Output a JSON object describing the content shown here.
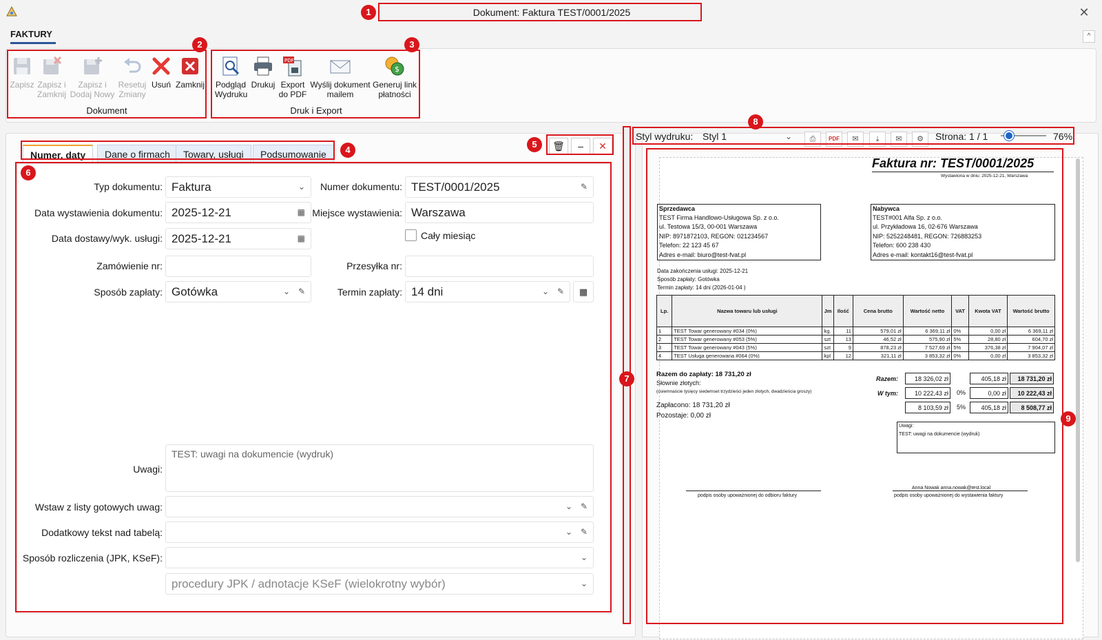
{
  "window": {
    "title": "Dokument: Faktura TEST/0001/2025",
    "close_glyph": "✕"
  },
  "ribbon": {
    "tab": "FAKTURY",
    "collapse_glyph": "^",
    "groups": [
      {
        "label": "Dokument"
      },
      {
        "label": "Druk i Export"
      }
    ],
    "buttons": {
      "save": "Zapisz",
      "save_close_1": "Zapisz i",
      "save_close_2": "Zamknij",
      "save_new_1": "Zapisz i",
      "save_new_2": "Dodaj Nowy",
      "reset_1": "Resetuj",
      "reset_2": "Zmiany",
      "delete": "Usuń",
      "close": "Zamknij",
      "preview_1": "Podgląd",
      "preview_2": "Wydruku",
      "print": "Drukuj",
      "pdf_1": "Export",
      "pdf_2": "do PDF",
      "mail_1": "Wyślij dokument",
      "mail_2": "mailem",
      "paylink_1": "Generuj link",
      "paylink_2": "płatności"
    }
  },
  "badges": [
    "1",
    "2",
    "3",
    "4",
    "5",
    "6",
    "7",
    "8",
    "9"
  ],
  "tabs": [
    "Numer, daty",
    "Dane o firmach",
    "Towary, usługi",
    "Podsumowanie"
  ],
  "tab_buttons": {
    "clear": "🗑",
    "minimize": "–",
    "close": "✕"
  },
  "form": {
    "doc_type_label": "Typ dokumentu:",
    "doc_type_value": "Faktura",
    "doc_number_label": "Numer dokumentu:",
    "doc_number_value": "TEST/0001/2025",
    "issue_date_label": "Data wystawienia dokumentu:",
    "issue_date_value": "2025-12-21",
    "place_label": "Miejsce wystawienia:",
    "place_value": "Warszawa",
    "delivery_date_label": "Data dostawy/wyk. usługi:",
    "delivery_date_value": "2025-12-21",
    "whole_month_label": "Cały miesiąc",
    "order_label": "Zamówienie nr:",
    "order_value": "",
    "shipment_label": "Przesyłka nr:",
    "shipment_value": "",
    "payment_label": "Sposób zapłaty:",
    "payment_value": "Gotówka",
    "due_label": "Termin zapłaty:",
    "due_value": "14 dni",
    "notes_label": "Uwagi:",
    "notes_value": "TEST: uwagi na dokumencie (wydruk)",
    "ready_notes_label": "Wstaw z listy gotowych uwag:",
    "extra_text_label": "Dodatkowy tekst nad tabelą:",
    "settlement_label": "Sposób rozliczenia (JPK, KSeF):",
    "procedures_placeholder": "procedury JPK / adnotacje KSeF (wielokrotny wybór)"
  },
  "preview_toolbar": {
    "style_label": "Styl wydruku:",
    "style_value": "Styl 1",
    "page_label": "Strona: 1 / 1",
    "zoom": "76%",
    "zoom_level": 0.18
  },
  "invoice": {
    "title": "Faktura nr: TEST/0001/2025",
    "issued": "Wystawiona w dniu: 2025-12-21, Warszawa",
    "seller": {
      "heading": "Sprzedawca",
      "lines": [
        "TEST Firma Handlowo-Usługowa Sp. z o.o.",
        "ul. Testowa 15/3, 00-001 Warszawa",
        "NIP: 8971872103, REGON: 021234567",
        "Telefon: 22 123 45 67",
        "Adres e-mail: biuro@test-fvat.pl"
      ]
    },
    "buyer": {
      "heading": "Nabywca",
      "lines": [
        "TEST#001 Alfa Sp. z o.o.",
        "ul. Przykładowa 16, 02-676 Warszawa",
        "NIP: 5252248481, REGON: 726883253",
        "Telefon: 600 238 430",
        "Adres e-mail: kontakt16@test-fvat.pl"
      ]
    },
    "meta": [
      "Data zakończenia usługi: 2025-12-21",
      "Sposób zapłaty: Gotówka",
      "Termin zapłaty: 14 dni (2026-01-04 )"
    ],
    "columns": [
      "Lp.",
      "Nazwa towaru lub usługi",
      "Jm",
      "Ilość",
      "Cena brutto",
      "Wartość netto",
      "VAT",
      "Kwota VAT",
      "Wartość brutto"
    ],
    "rows": [
      [
        "1",
        "TEST Towar generowany #034 (0%)",
        "kg.",
        "11",
        "579,01 zł",
        "6 369,11 zł",
        "0%",
        "0,00 zł",
        "6 369,11 zł"
      ],
      [
        "2",
        "TEST Towar generowany #053 (5%)",
        "szt",
        "13",
        "46,52 zł",
        "575,90 zł",
        "5%",
        "28,80 zł",
        "604,70 zł"
      ],
      [
        "3",
        "TEST Towar generowany #043 (5%)",
        "szt",
        "9",
        "878,23 zł",
        "7 527,69 zł",
        "5%",
        "376,38 zł",
        "7 904,07 zł"
      ],
      [
        "4",
        "TEST Usługa generowana #064 (0%)",
        "kpl",
        "12",
        "321,11 zł",
        "3 853,32 zł",
        "0%",
        "0,00 zł",
        "3 853,32 zł"
      ]
    ],
    "total_label": "Razem do zapłaty: 18 731,20 zł",
    "words_label": "Słownie złotych:",
    "words": "(osiemnaście tysięcy siedemset trzydzieści jeden złotych, dwadzieścia groszy)",
    "paid": "Zapłacono: 18 731,20 zł",
    "remaining": "Pozostaje: 0,00 zł",
    "summary_razem": "Razem:",
    "summary_wtym": "W tym:",
    "summary_rows": [
      [
        "18 326,02 zł",
        "",
        "405,18 zł",
        "18 731,20 zł"
      ],
      [
        "10 222,43 zł",
        "0%",
        "0,00 zł",
        "10 222,43 zł"
      ],
      [
        "8 103,59 zł",
        "5%",
        "405,18 zł",
        "8 508,77 zł"
      ]
    ],
    "notes_heading": "Uwagi:",
    "notes": "TEST: uwagi na dokumencie (wydruk)",
    "sign_left": "podpis osoby upoważnionej do odbioru faktury",
    "sign_right_name": "Anna Nowak anna.nowak@test.local",
    "sign_right": "podpis osoby upoważnionej do wystawienia faktury"
  }
}
